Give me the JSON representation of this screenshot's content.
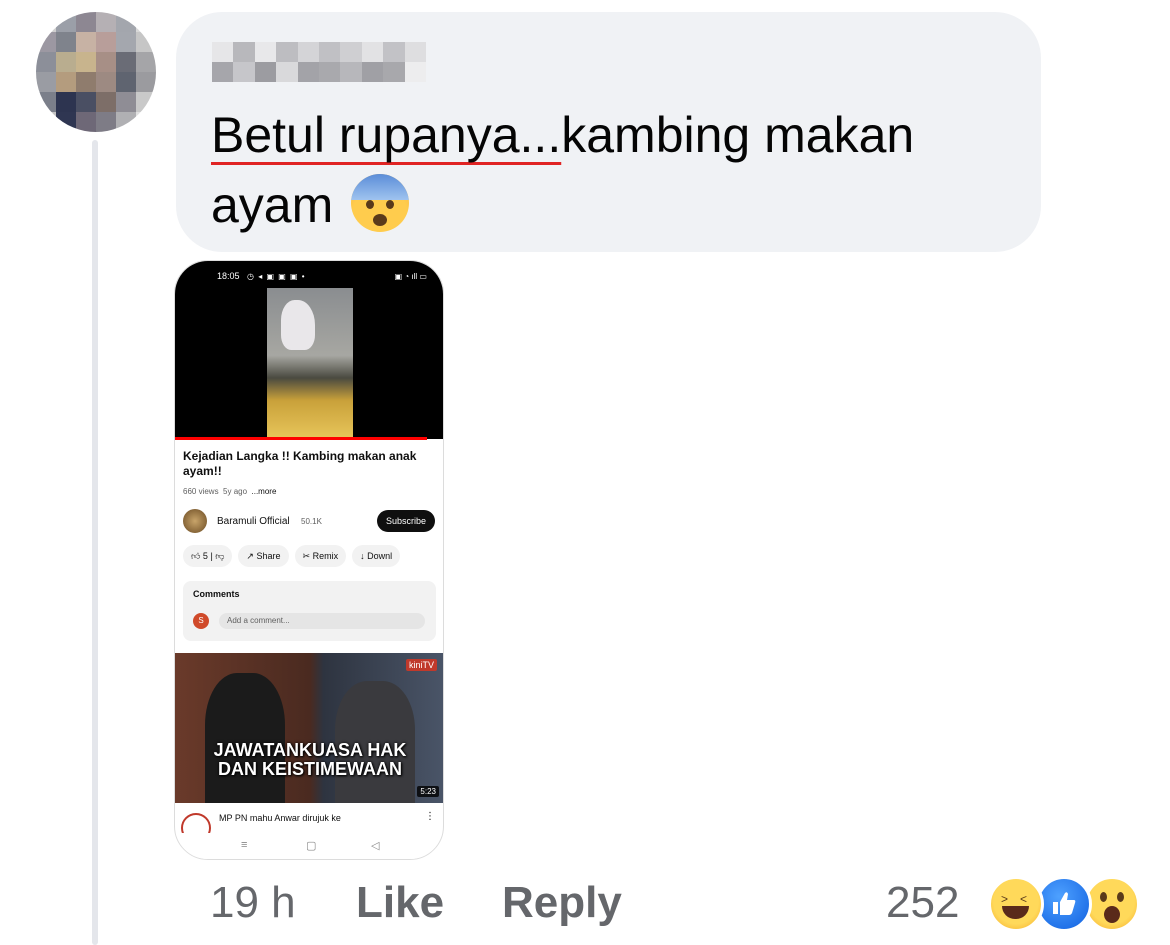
{
  "comment": {
    "text_underlined": "Betul rupanya...",
    "text_rest": "kambing makan ayam",
    "emoji": "fearful-face-emoji"
  },
  "attachment": {
    "status_time": "18:05",
    "video_title": "Kejadian Langka !! Kambing makan anak ayam!!",
    "views": "660 views",
    "age": "5y ago",
    "more": "...more",
    "channel_name": "Baramuli Official",
    "channel_subs": "50.1K",
    "subscribe_label": "Subscribe",
    "like_count": "5",
    "share_label": "Share",
    "remix_label": "Remix",
    "download_label": "Downl",
    "comments_title": "Comments",
    "commenter_initial": "S",
    "add_comment_placeholder": "Add a comment...",
    "next_video_overlay_line1": "JAWATANKUASA HAK",
    "next_video_overlay_line2": "DAN KEISTIMEWAAN",
    "next_video_channel_badge": "kiniTV",
    "next_video_duration": "5:23",
    "next_video_title": "MP PN mahu Anwar dirujuk ke"
  },
  "footer": {
    "time_ago": "19 h",
    "like_label": "Like",
    "reply_label": "Reply",
    "reaction_count": "252",
    "reactions": [
      "haha-icon",
      "like-icon",
      "wow-icon"
    ]
  },
  "colors": {
    "bubble": "#f0f2f5",
    "secondary_text": "#65676b",
    "like_blue": "#1877f2"
  }
}
